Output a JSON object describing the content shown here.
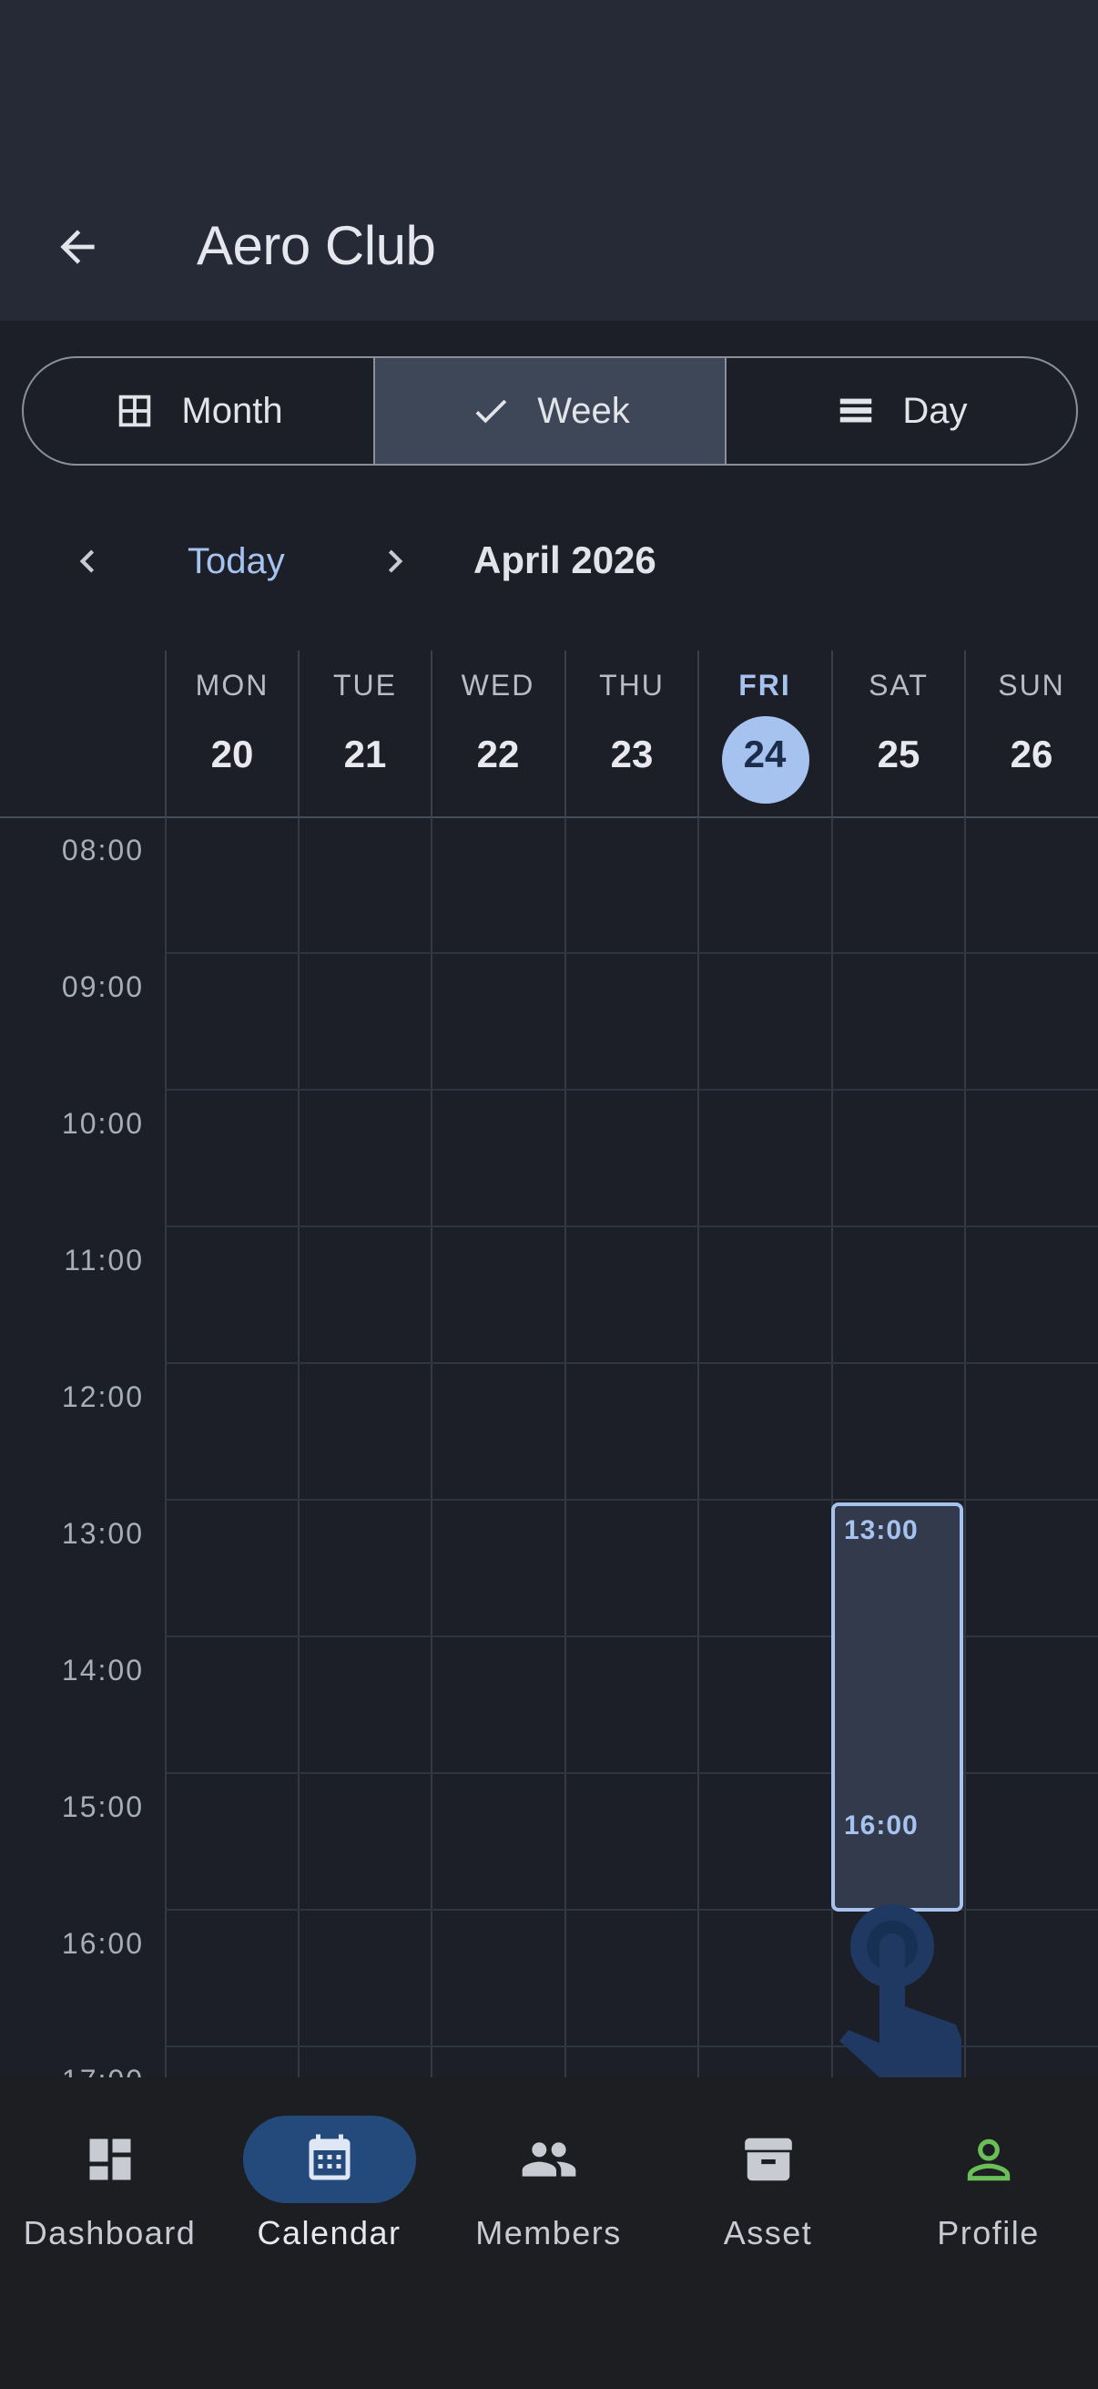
{
  "app_bar": {
    "title": "Aero Club"
  },
  "view_switcher": {
    "options": [
      {
        "label": "Month",
        "icon": "grid-icon",
        "selected": false
      },
      {
        "label": "Week",
        "icon": "check-icon",
        "selected": true
      },
      {
        "label": "Day",
        "icon": "day-lines-icon",
        "selected": false
      }
    ]
  },
  "date_nav": {
    "today_label": "Today",
    "period_label": "April 2026"
  },
  "week": {
    "days": [
      {
        "name": "MON",
        "num": "20",
        "today": false
      },
      {
        "name": "TUE",
        "num": "21",
        "today": false
      },
      {
        "name": "WED",
        "num": "22",
        "today": false
      },
      {
        "name": "THU",
        "num": "23",
        "today": false
      },
      {
        "name": "FRI",
        "num": "24",
        "today": true
      },
      {
        "name": "SAT",
        "num": "25",
        "today": false
      },
      {
        "name": "SUN",
        "num": "26",
        "today": false
      }
    ],
    "hours": [
      "08:00",
      "09:00",
      "10:00",
      "11:00",
      "12:00",
      "13:00",
      "14:00",
      "15:00",
      "16:00",
      "17:00"
    ]
  },
  "selection": {
    "day": "SAT",
    "start_label": "13:00",
    "end_label": "16:00"
  },
  "bottom_nav": {
    "items": [
      {
        "label": "Dashboard",
        "icon": "dashboard-icon",
        "active": false
      },
      {
        "label": "Calendar",
        "icon": "calendar-icon",
        "active": true
      },
      {
        "label": "Members",
        "icon": "members-icon",
        "active": false
      },
      {
        "label": "Asset",
        "icon": "archive-icon",
        "active": false
      },
      {
        "label": "Profile",
        "icon": "profile-icon",
        "active": false
      }
    ]
  },
  "colors": {
    "accent": "#a6c3f0",
    "background": "#1c1f28",
    "app_bar": "#262a37",
    "active_nav_pill": "#234a7a",
    "profile_icon": "#6bbf59"
  }
}
